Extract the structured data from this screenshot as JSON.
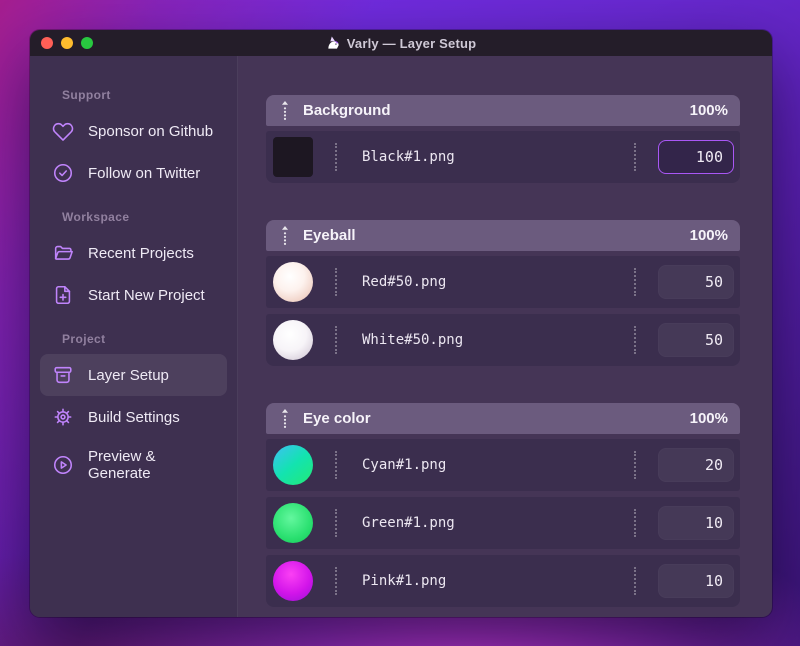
{
  "window": {
    "title": "Varly — Layer Setup",
    "app_icon": "unicorn-icon",
    "traffic_lights": [
      "close",
      "minimize",
      "zoom"
    ]
  },
  "sidebar": {
    "sections": [
      {
        "label": "Support",
        "items": [
          {
            "label": "Sponsor on Github",
            "icon": "heart-icon"
          },
          {
            "label": "Follow on Twitter",
            "icon": "badge-check-icon"
          }
        ]
      },
      {
        "label": "Workspace",
        "items": [
          {
            "label": "Recent Projects",
            "icon": "folder-open-icon"
          },
          {
            "label": "Start New Project",
            "icon": "file-plus-icon"
          }
        ]
      },
      {
        "label": "Project",
        "items": [
          {
            "label": "Layer Setup",
            "icon": "archive-icon",
            "active": true
          },
          {
            "label": "Build Settings",
            "icon": "gear-icon"
          },
          {
            "label": "Preview & Generate",
            "icon": "play-circle-icon"
          }
        ]
      }
    ]
  },
  "layers": {
    "groups": [
      {
        "name": "Background",
        "percent": "100%",
        "rows": [
          {
            "filename": "Black#1.png",
            "value": "100",
            "thumb": "black-square-thumbnail",
            "focused": true
          }
        ]
      },
      {
        "name": "Eyeball",
        "percent": "100%",
        "rows": [
          {
            "filename": "Red#50.png",
            "value": "50",
            "thumb": "red-sphere-thumbnail"
          },
          {
            "filename": "White#50.png",
            "value": "50",
            "thumb": "white-sphere-thumbnail"
          }
        ]
      },
      {
        "name": "Eye color",
        "percent": "100%",
        "rows": [
          {
            "filename": "Cyan#1.png",
            "value": "20",
            "thumb": "cyan-circle-thumbnail"
          },
          {
            "filename": "Green#1.png",
            "value": "10",
            "thumb": "green-circle-thumbnail"
          },
          {
            "filename": "Pink#1.png",
            "value": "10",
            "thumb": "pink-circle-thumbnail"
          }
        ]
      }
    ]
  },
  "colors": {
    "accent": "#a855f7",
    "icon_stroke": "#c084fc",
    "titlebar_bg": "#241d29",
    "sidebar_bg": "#3e3050",
    "content_bg": "#453556",
    "group_header_bg": "#6b5b7e",
    "row_bg": "#3b2e4e",
    "traffic_close": "#ff5f57",
    "traffic_minimize": "#febc2e",
    "traffic_zoom": "#28c840",
    "thumb_black": "#1d1722",
    "thumb_cyan_gradient": [
      "#3ec0f5",
      "#23ea75"
    ],
    "thumb_green_gradient": [
      "#63f79e",
      "#15c457"
    ],
    "thumb_pink_gradient": [
      "#fb40f4",
      "#9a10d8"
    ]
  }
}
